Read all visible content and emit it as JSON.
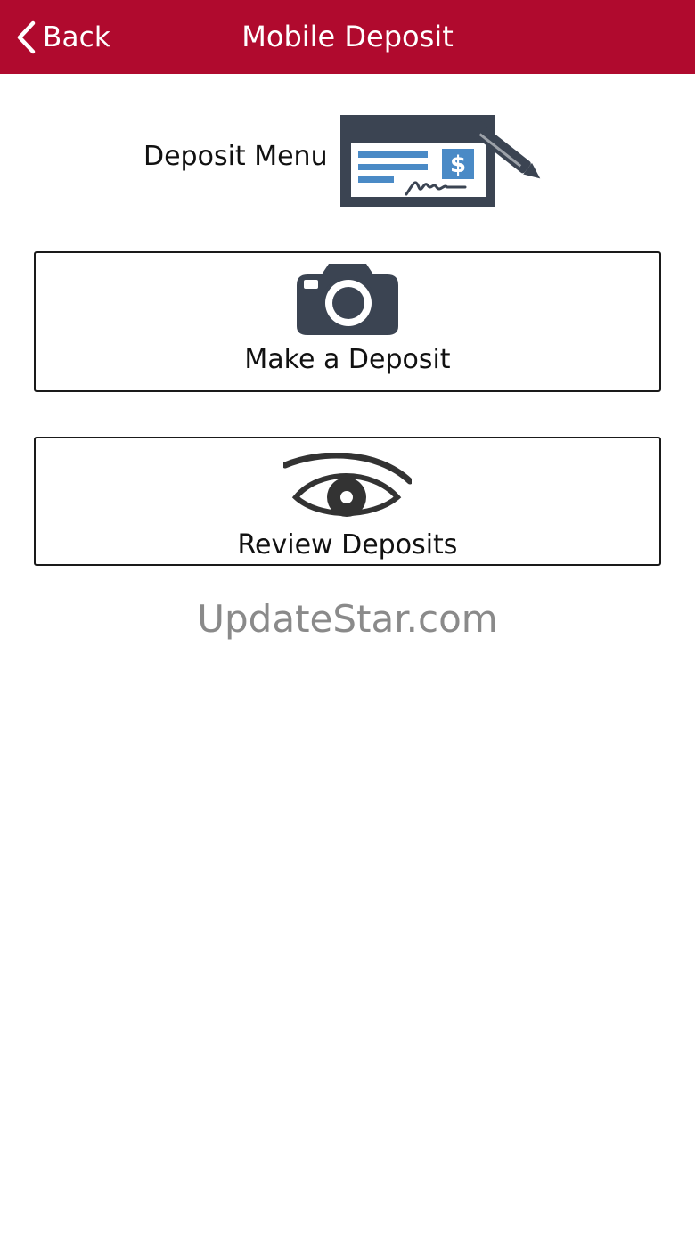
{
  "nav": {
    "back_label": "Back",
    "title": "Mobile Deposit",
    "bar_color": "#b00a2e"
  },
  "header": {
    "title": "Deposit Menu",
    "icon": "check-pen-icon"
  },
  "menu": {
    "items": [
      {
        "label": "Make a Deposit",
        "icon": "camera-icon"
      },
      {
        "label": "Review Deposits",
        "icon": "eye-icon"
      }
    ]
  },
  "watermark": {
    "text": "UpdateStar.com"
  },
  "colors": {
    "icon_dark": "#3b4452",
    "check_blue": "#4a8ac6"
  }
}
